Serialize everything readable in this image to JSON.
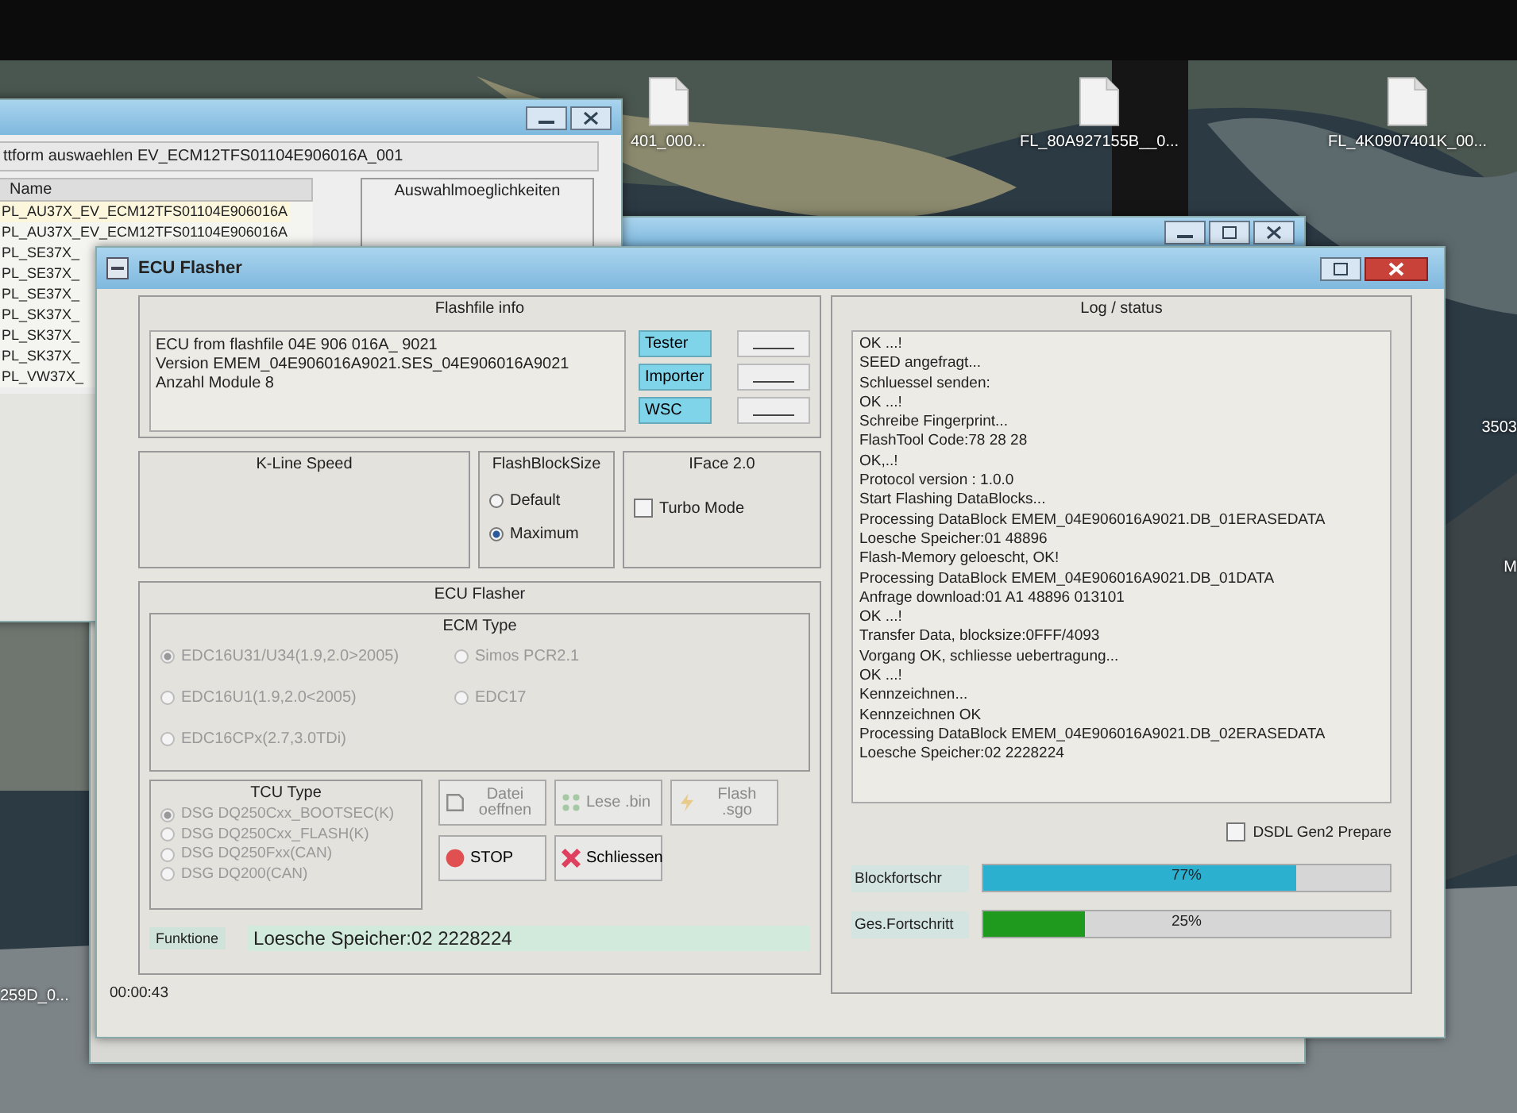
{
  "desktop_icons": [
    {
      "label": "401_000...",
      "kind": "file"
    },
    {
      "label": "FL_80A927155B__0...",
      "kind": "file"
    },
    {
      "label": "FL_4K0907401K_00...",
      "kind": "file"
    },
    {
      "label": "3503",
      "kind": "label"
    },
    {
      "label": "M",
      "kind": "label"
    },
    {
      "label": "259D_0...",
      "kind": "label"
    }
  ],
  "back_window": {
    "breadcrumb": "ttform auswaehlen EV_ECM12TFS01104E906016A_001",
    "column": "Name",
    "rows": [
      {
        "name": "PL_AU37X_EV_ECM12TFS01104E906016A",
        "selected": true
      },
      {
        "name": "PL_AU37X_EV_ECM12TFS01104E906016A",
        "selected": false
      },
      {
        "name": "PL_SE37X_",
        "selected": false
      },
      {
        "name": "PL_SE37X_",
        "selected": false
      },
      {
        "name": "PL_SE37X_",
        "selected": false
      },
      {
        "name": "PL_SK37X_",
        "selected": false
      },
      {
        "name": "PL_SK37X_",
        "selected": false
      },
      {
        "name": "PL_SK37X_",
        "selected": false
      },
      {
        "name": "PL_VW37X_",
        "selected": false
      }
    ],
    "group": "Auswahlmoeglichkeiten"
  },
  "window": {
    "title": "ECU Flasher"
  },
  "flashfile_info": {
    "title": "Flashfile info",
    "lines": [
      "ECU from flashfile 04E 906 016A_ 9021",
      "Version EMEM_04E906016A9021.SES_04E906016A9021",
      "Anzahl Module 8"
    ],
    "buttons": [
      "Tester",
      "Importer",
      "WSC"
    ]
  },
  "kline": {
    "title": "K-Line Speed"
  },
  "flash_block_size": {
    "title": "FlashBlockSize",
    "options": [
      {
        "label": "Default",
        "selected": false
      },
      {
        "label": "Maximum",
        "selected": true
      }
    ]
  },
  "iface": {
    "title": "IFace 2.0",
    "turbo": {
      "label": "Turbo Mode",
      "checked": false
    }
  },
  "ecu_flasher": {
    "title": "ECU Flasher",
    "ecm": {
      "title": "ECM Type",
      "options": [
        {
          "label": "EDC16U31/U34(1.9,2.0>2005)",
          "selected": true,
          "disabled": true
        },
        {
          "label": "Simos PCR2.1",
          "selected": false,
          "disabled": true
        },
        {
          "label": "EDC16U1(1.9,2.0<2005)",
          "selected": false,
          "disabled": true
        },
        {
          "label": "EDC17",
          "selected": false,
          "disabled": true
        },
        {
          "label": "EDC16CPx(2.7,3.0TDi)",
          "selected": false,
          "disabled": true
        }
      ]
    },
    "tcu": {
      "title": "TCU Type",
      "options": [
        {
          "label": "DSG DQ250Cxx_BOOTSEC(K)",
          "selected": true,
          "disabled": true
        },
        {
          "label": "DSG DQ250Cxx_FLASH(K)",
          "selected": false,
          "disabled": true
        },
        {
          "label": "DSG DQ250Fxx(CAN)",
          "selected": false,
          "disabled": true
        },
        {
          "label": "DSG DQ200(CAN)",
          "selected": false,
          "disabled": true
        }
      ]
    },
    "actions": [
      {
        "kind": "open",
        "label": "Datei oeffnen",
        "disabled": true
      },
      {
        "kind": "read",
        "label": "Lese .bin",
        "disabled": true
      },
      {
        "kind": "flash",
        "label": "Flash .sgo",
        "disabled": true
      },
      {
        "kind": "stop",
        "label": "STOP",
        "disabled": false
      },
      {
        "kind": "close",
        "label": "Schliessen",
        "disabled": false
      }
    ],
    "function_label": "Funktione",
    "function_value": "Loesche Speicher:02 2228224"
  },
  "elapsed": "00:00:43",
  "log": {
    "title": "Log / status",
    "lines": [
      "OK ...!",
      "SEED angefragt...",
      "Schluessel senden:",
      "OK ...!",
      "Schreibe Fingerprint...",
      "FlashTool Code:78 28 28",
      "OK,..!",
      "Protocol version : 1.0.0",
      "Start Flashing DataBlocks...",
      "Processing DataBlock EMEM_04E906016A9021.DB_01ERASEDATA",
      "Loesche Speicher:01 48896",
      "Flash-Memory geloescht, OK!",
      "Processing DataBlock EMEM_04E906016A9021.DB_01DATA",
      "Anfrage download:01 A1 48896 013101",
      "OK ...!",
      "Transfer Data, blocksize:0FFF/4093",
      "Vorgang OK, schliesse uebertragung...",
      "OK ...!",
      "Kennzeichnen...",
      "Kennzeichnen OK",
      "Processing DataBlock EMEM_04E906016A9021.DB_02ERASEDATA",
      "Loesche Speicher:02 2228224"
    ],
    "dsdl": {
      "label": "DSDL Gen2 Prepare",
      "checked": false
    },
    "progress": [
      {
        "kind": "block",
        "label": "Blockfortschr",
        "level": 0.77,
        "reading": "77%"
      },
      {
        "kind": "total",
        "label": "Ges.Fortschritt",
        "level": 0.25,
        "reading": "25%"
      }
    ]
  }
}
